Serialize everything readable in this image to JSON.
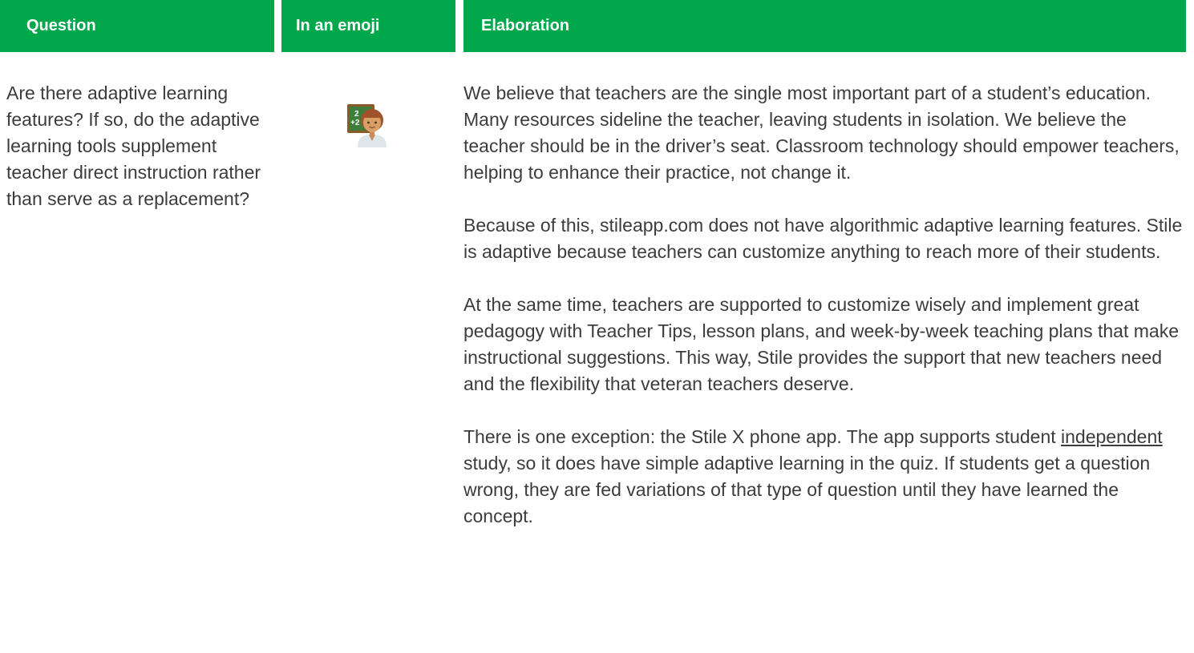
{
  "headers": {
    "question": "Question",
    "emoji": "In an emoji",
    "elaboration": "Elaboration"
  },
  "row": {
    "question": "Are there adaptive learning features? If so, do the adaptive learning tools supplement teacher direct instruction rather than serve as a replacement?",
    "emoji_icon": "teacher-emoji-icon",
    "emoji_chalkboard_text": "2+2",
    "elaboration": {
      "p1": "We believe that teachers are the single most important part of a student’s education. Many resources sideline the teacher, leaving students in isolation. We believe the teacher should be in the driver’s seat. Classroom technology should empower teachers, helping to enhance their practice, not change it.",
      "p2": "Because of this, stileapp.com does not have algorithmic adaptive learning features. Stile is adaptive because teachers can customize anything to reach more of their students.",
      "p3": "At the same time, teachers are supported to customize wisely and implement great pedagogy with Teacher Tips, lesson plans, and week-by-week teaching plans that make instructional suggestions. This way, Stile provides the support that new teachers need and the flexibility that veteran teachers deserve.",
      "p4_before": "There is one exception: the Stile X phone app. The app supports student ",
      "p4_link": "independent",
      "p4_after": " study, so it does have simple adaptive learning in the quiz. If students get a question wrong, they are fed variations of that type of question until they have learned the concept."
    }
  },
  "colors": {
    "header_bg": "#00a84b",
    "header_text": "#ffffff",
    "body_text": "#3c3c3c"
  }
}
